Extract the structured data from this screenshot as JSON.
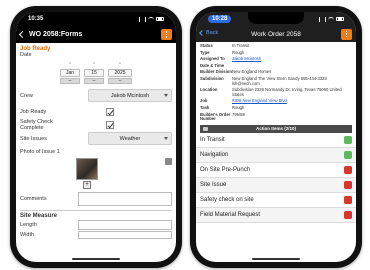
{
  "left_phone": {
    "status_time": "10:35",
    "title": "WO 2058:Forms",
    "section_title": "Job Ready",
    "date_label": "Date",
    "date": {
      "month": "Jan",
      "day": "15",
      "year": "2025"
    },
    "crew_label": "Crew",
    "crew_value": "Jakob Mcintosh",
    "job_ready_label": "Job Ready",
    "safety_label": "Safety Check Complete",
    "site_issues_label": "Site Issues",
    "site_issues_value": "Weather",
    "photo_label": "Photo of Issue 1",
    "comments_label": "Comments",
    "measure_title": "Site Measure",
    "length_label": "Length",
    "width_label": "Width"
  },
  "right_phone": {
    "status_time": "10:28",
    "back_label": "Back",
    "title": "Work Order 2058",
    "details": [
      {
        "k": "Status",
        "v": "In Transit"
      },
      {
        "k": "Type",
        "v": "Rough"
      },
      {
        "k": "Assigned To",
        "v": "Jakob Mcintosh",
        "link": true
      },
      {
        "k": "Date & Time",
        "v": ""
      },
      {
        "k": "Builder Division",
        "v": "New England Homes"
      },
      {
        "k": "Subdivision",
        "v": "New England The View Stern Sandy 555-444-3333 lsh@nech.com"
      },
      {
        "k": "Location",
        "v": "Subdivision 2326 Normandy Dr. Irving, Texas 75060 United States"
      },
      {
        "k": "Job",
        "v": "#308 New England View Blvd",
        "link": true
      },
      {
        "k": "Task",
        "v": "Rough"
      },
      {
        "k": "Builder's Order Number",
        "v": "795/88"
      }
    ],
    "action_header": "Action Items (2/10)",
    "actions": [
      {
        "label": "In Transit",
        "status": "green"
      },
      {
        "label": "Navigation",
        "status": "green"
      },
      {
        "label": "On Site Pre-Punch",
        "status": "red"
      },
      {
        "label": "Site Issue",
        "status": "red"
      },
      {
        "label": "Safety check on site",
        "status": "red"
      },
      {
        "label": "Field Material Request",
        "status": "red"
      }
    ]
  }
}
